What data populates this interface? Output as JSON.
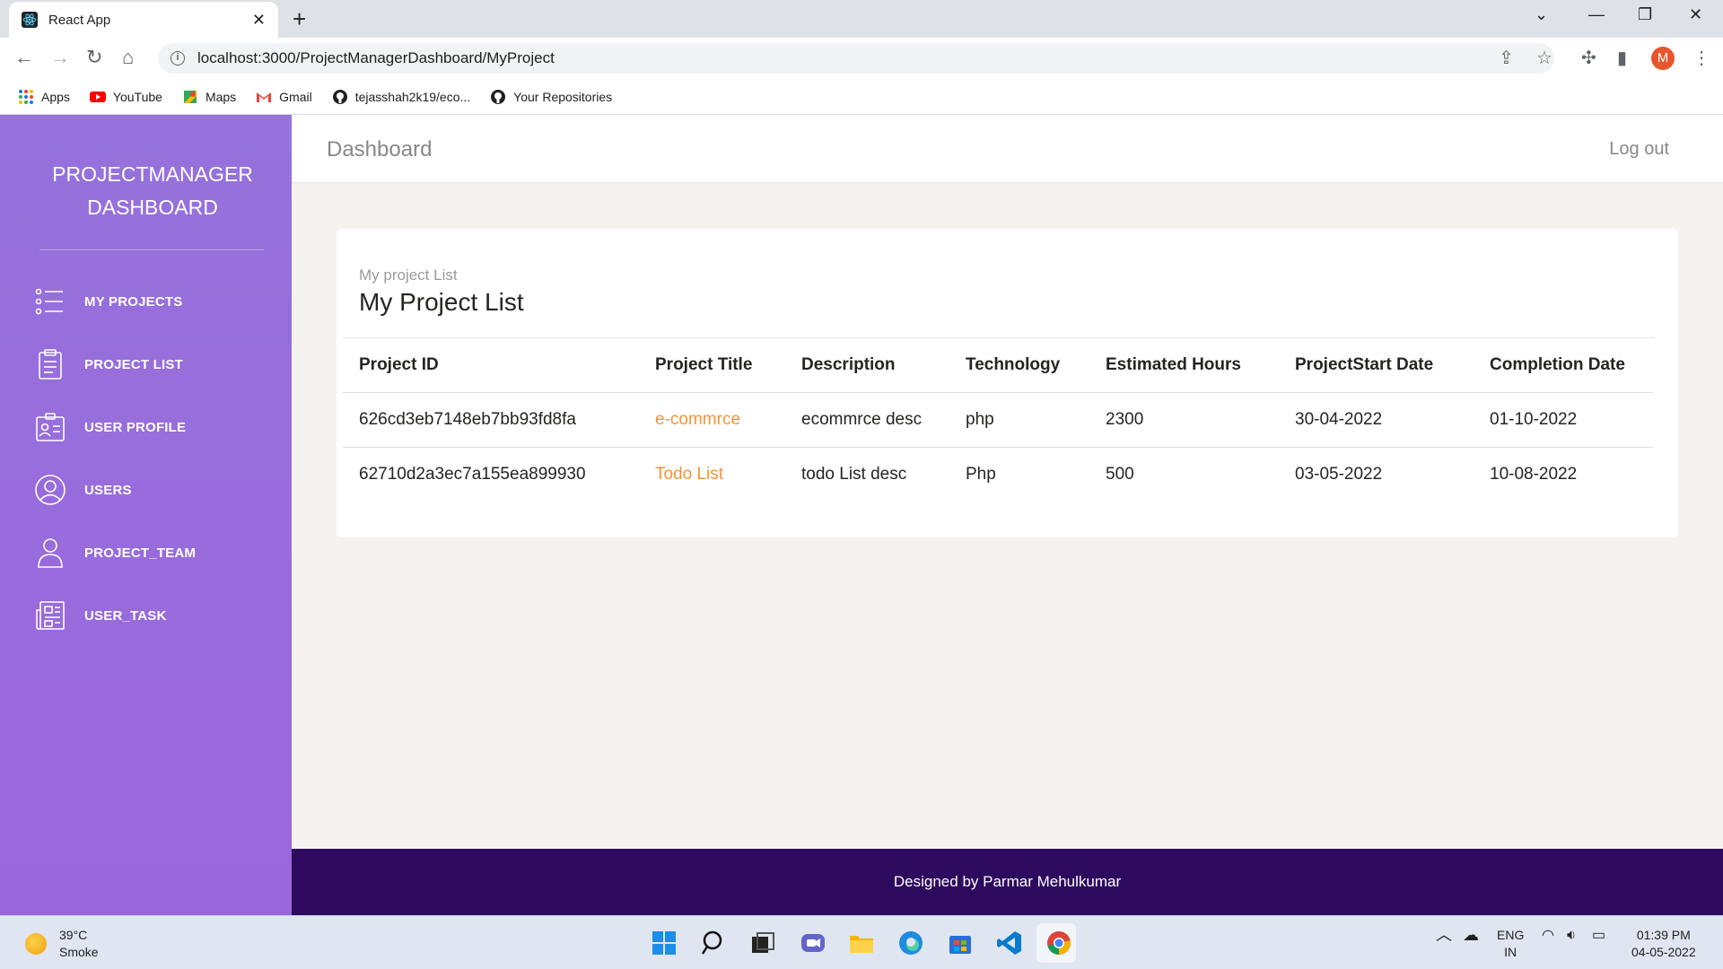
{
  "browser": {
    "tab_title": "React App",
    "url": "localhost:3000/ProjectManagerDashboard/MyProject",
    "profile_initial": "M",
    "bookmarks": [
      {
        "label": "Apps",
        "icon": "apps-grid-icon"
      },
      {
        "label": "YouTube",
        "icon": "youtube-icon"
      },
      {
        "label": "Maps",
        "icon": "maps-icon"
      },
      {
        "label": "Gmail",
        "icon": "gmail-icon"
      },
      {
        "label": "tejasshah2k19/eco...",
        "icon": "github-icon"
      },
      {
        "label": "Your Repositories",
        "icon": "github-icon"
      }
    ]
  },
  "sidebar": {
    "brand_line1": "PROJECTMANAGER",
    "brand_line2": "DASHBOARD",
    "items": [
      {
        "label": "MY PROJECTS",
        "icon": "list-icon"
      },
      {
        "label": "PROJECT LIST",
        "icon": "clipboard-icon"
      },
      {
        "label": "USER PROFILE",
        "icon": "profile-card-icon"
      },
      {
        "label": "USERS",
        "icon": "user-circle-icon"
      },
      {
        "label": "PROJECT_TEAM",
        "icon": "person-icon"
      },
      {
        "label": "USER_TASK",
        "icon": "task-news-icon"
      }
    ]
  },
  "header": {
    "title": "Dashboard",
    "logout": "Log out"
  },
  "card": {
    "category": "My project List",
    "title": "My Project List",
    "columns": [
      "Project ID",
      "Project Title",
      "Description",
      "Technology",
      "Estimated Hours",
      "ProjectStart Date",
      "Completion Date"
    ],
    "rows": [
      {
        "id": "626cd3eb7148eb7bb93fd8fa",
        "title": "e-commrce",
        "description": "ecommrce desc",
        "technology": "php",
        "hours": "2300",
        "start": "30-04-2022",
        "end": "01-10-2022"
      },
      {
        "id": "62710d2a3ec7a155ea899930",
        "title": "Todo List",
        "description": "todo List desc",
        "technology": "Php",
        "hours": "500",
        "start": "03-05-2022",
        "end": "10-08-2022"
      }
    ]
  },
  "footer": {
    "text": "Designed by Parmar Mehulkumar"
  },
  "taskbar": {
    "temperature": "39°C",
    "weather": "Smoke",
    "lang1": "ENG",
    "lang2": "IN",
    "time": "01:39 PM",
    "date": "04-05-2022"
  },
  "colors": {
    "sidebar": "#9a6ddc",
    "link": "#f59434",
    "footer": "#2d0a5e"
  }
}
